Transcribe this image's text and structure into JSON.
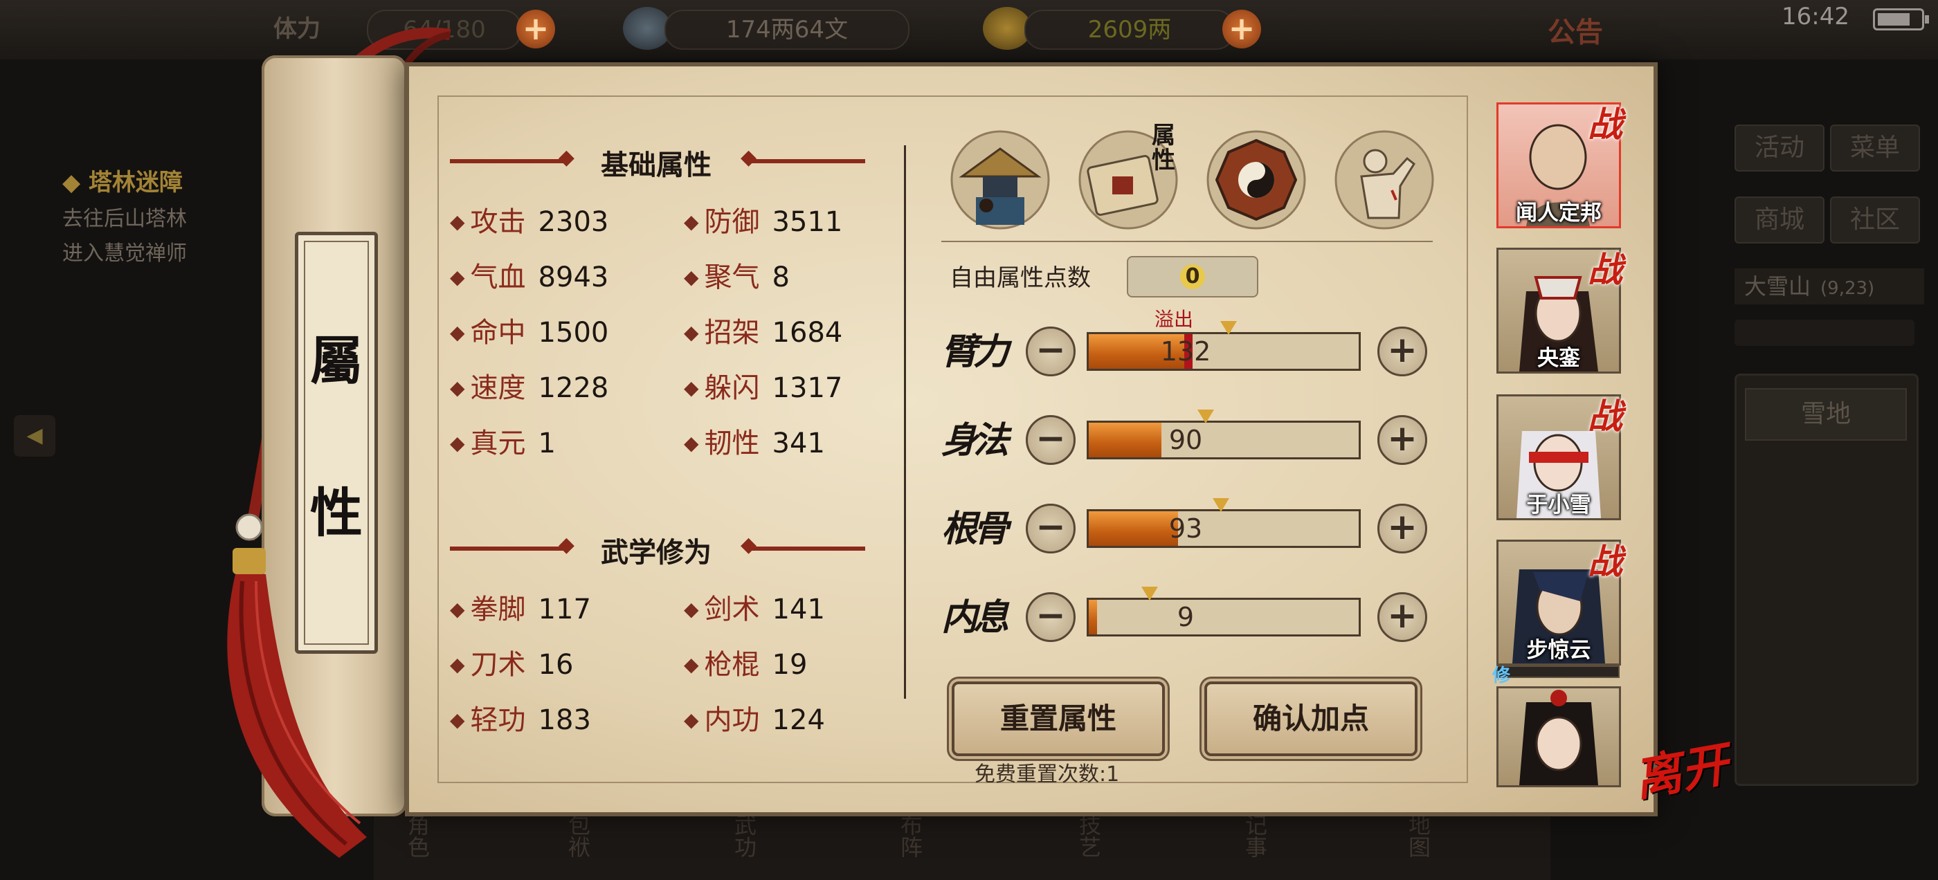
{
  "topbar": {
    "stamina_label": "体力",
    "stamina_value": "64/180",
    "silver_value": "174两64文",
    "gold_value": "2609两",
    "notice_label": "公告",
    "time": "16:42",
    "plus_symbol": "+"
  },
  "quest": {
    "title": "◆ 塔林迷障",
    "line1": "去往后山塔林",
    "line2": "进入慧觉禅师"
  },
  "right_panel": {
    "buttons": [
      "活动",
      "菜单",
      "商城",
      "社区"
    ],
    "map_name": "大雪山",
    "map_coords": "(9,23)",
    "area_button": "雪地"
  },
  "bottom_nav": [
    "角色",
    "包袱",
    "武功",
    "布阵",
    "技艺",
    "记事",
    "地图"
  ],
  "scroll": {
    "label_top": "屬",
    "label_bottom": "性"
  },
  "basic_attributes": {
    "title": "基础属性",
    "items": [
      {
        "label": "攻击",
        "value": "2303"
      },
      {
        "label": "防御",
        "value": "3511"
      },
      {
        "label": "气血",
        "value": "8943"
      },
      {
        "label": "聚气",
        "value": "8"
      },
      {
        "label": "命中",
        "value": "1500"
      },
      {
        "label": "招架",
        "value": "1684"
      },
      {
        "label": "速度",
        "value": "1228"
      },
      {
        "label": "躲闪",
        "value": "1317"
      },
      {
        "label": "真元",
        "value": "1"
      },
      {
        "label": "韧性",
        "value": "341"
      }
    ]
  },
  "martial_cultivation": {
    "title": "武学修为",
    "items": [
      {
        "label": "拳脚",
        "value": "117"
      },
      {
        "label": "剑术",
        "value": "141"
      },
      {
        "label": "刀术",
        "value": "16"
      },
      {
        "label": "枪棍",
        "value": "19"
      },
      {
        "label": "轻功",
        "value": "183"
      },
      {
        "label": "内功",
        "value": "124"
      }
    ]
  },
  "tabs": {
    "selected_label": "属性",
    "icons": [
      "character-hat-icon",
      "scroll-attributes-icon",
      "bagua-icon",
      "body-meridian-icon"
    ]
  },
  "points": {
    "free_label": "自由属性点数",
    "free_value": "0",
    "overflow_label": "溢出",
    "minus_symbol": "−",
    "plus_symbol": "+",
    "attributes": [
      {
        "name": "臂力",
        "value": "132",
        "fill": 0.36
      },
      {
        "name": "身法",
        "value": "90",
        "fill": 0.27
      },
      {
        "name": "根骨",
        "value": "93",
        "fill": 0.33
      },
      {
        "name": "内息",
        "value": "9",
        "fill": 0.03
      }
    ]
  },
  "actions": {
    "reset_label": "重置属性",
    "confirm_label": "确认加点",
    "free_reset_count": "免费重置次数:1"
  },
  "party": {
    "battle_badge": "战",
    "cultivate_tag": "修",
    "members": [
      "闻人定邦",
      "央銮",
      "于小雪",
      "步惊云",
      ""
    ]
  },
  "leave_label": "离开",
  "colors": {
    "accent_red": "#8a2a1c",
    "bar_orange": "#c55f12",
    "overflow_red": "#b0141a",
    "parchment": "#e3d2b0"
  }
}
